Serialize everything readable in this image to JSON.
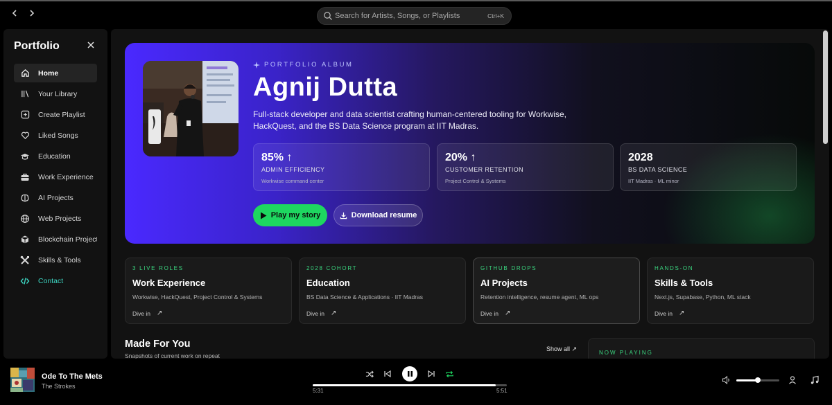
{
  "search": {
    "placeholder": "Search for Artists, Songs, or Playlists",
    "shortcut": "Ctrl+K"
  },
  "sidebar": {
    "title": "Portfolio",
    "items": [
      {
        "label": "Home",
        "icon": "home-icon",
        "active": true
      },
      {
        "label": "Your Library",
        "icon": "library-icon"
      },
      {
        "label": "Create Playlist",
        "icon": "plus-square-icon"
      },
      {
        "label": "Liked Songs",
        "icon": "heart-icon"
      },
      {
        "label": "Education",
        "icon": "graduation-cap-icon"
      },
      {
        "label": "Work Experience",
        "icon": "briefcase-icon"
      },
      {
        "label": "AI Projects",
        "icon": "brain-icon"
      },
      {
        "label": "Web Projects",
        "icon": "globe-icon"
      },
      {
        "label": "Blockchain Projects",
        "icon": "cube-icon"
      },
      {
        "label": "Skills & Tools",
        "icon": "tools-icon"
      },
      {
        "label": "Contact",
        "icon": "code-icon"
      }
    ]
  },
  "hero": {
    "eyebrow": "PORTFOLIO ALBUM",
    "name": "Agnij Dutta",
    "description": "Full-stack developer and data scientist crafting human-centered tooling for Workwise, HackQuest, and the BS Data Science program at IIT Madras.",
    "stats": [
      {
        "value": "85% ↑",
        "label": "ADMIN EFFICIENCY",
        "sub": "Workwise command center"
      },
      {
        "value": "20% ↑",
        "label": "CUSTOMER RETENTION",
        "sub": "Project Control & Systems"
      },
      {
        "value": "2028",
        "label": "BS DATA SCIENCE",
        "sub": "IIT Madras · ML minor"
      }
    ],
    "play_label": "Play my story",
    "download_label": "Download resume"
  },
  "cards": [
    {
      "kicker": "3 LIVE ROLES",
      "title": "Work Experience",
      "desc": "Workwise, HackQuest, Project Control & Systems",
      "action": "Dive in"
    },
    {
      "kicker": "2028 COHORT",
      "title": "Education",
      "desc": "BS Data Science & Applications · IIT Madras",
      "action": "Dive in"
    },
    {
      "kicker": "GITHUB DROPS",
      "title": "AI Projects",
      "desc": "Retention intelligence, resume agent, ML ops",
      "action": "Dive in"
    },
    {
      "kicker": "HANDS-ON",
      "title": "Skills & Tools",
      "desc": "Next.js, Supabase, Python, ML stack",
      "action": "Dive in"
    }
  ],
  "made_for_you": {
    "title": "Made For You",
    "subtitle": "Snapshots of current work on repeat",
    "show_all": "Show all"
  },
  "now_playing_panel": {
    "kicker": "NOW PLAYING"
  },
  "player": {
    "song": "Ode To The Mets",
    "artist": "The Strokes",
    "current_time": "5:31",
    "total_time": "5:51",
    "progress": 0.943,
    "volume": 0.5
  },
  "colors": {
    "accent_green": "#1ed760",
    "hero_purple": "#4a29ff",
    "contact_teal": "#3dd7c3"
  }
}
